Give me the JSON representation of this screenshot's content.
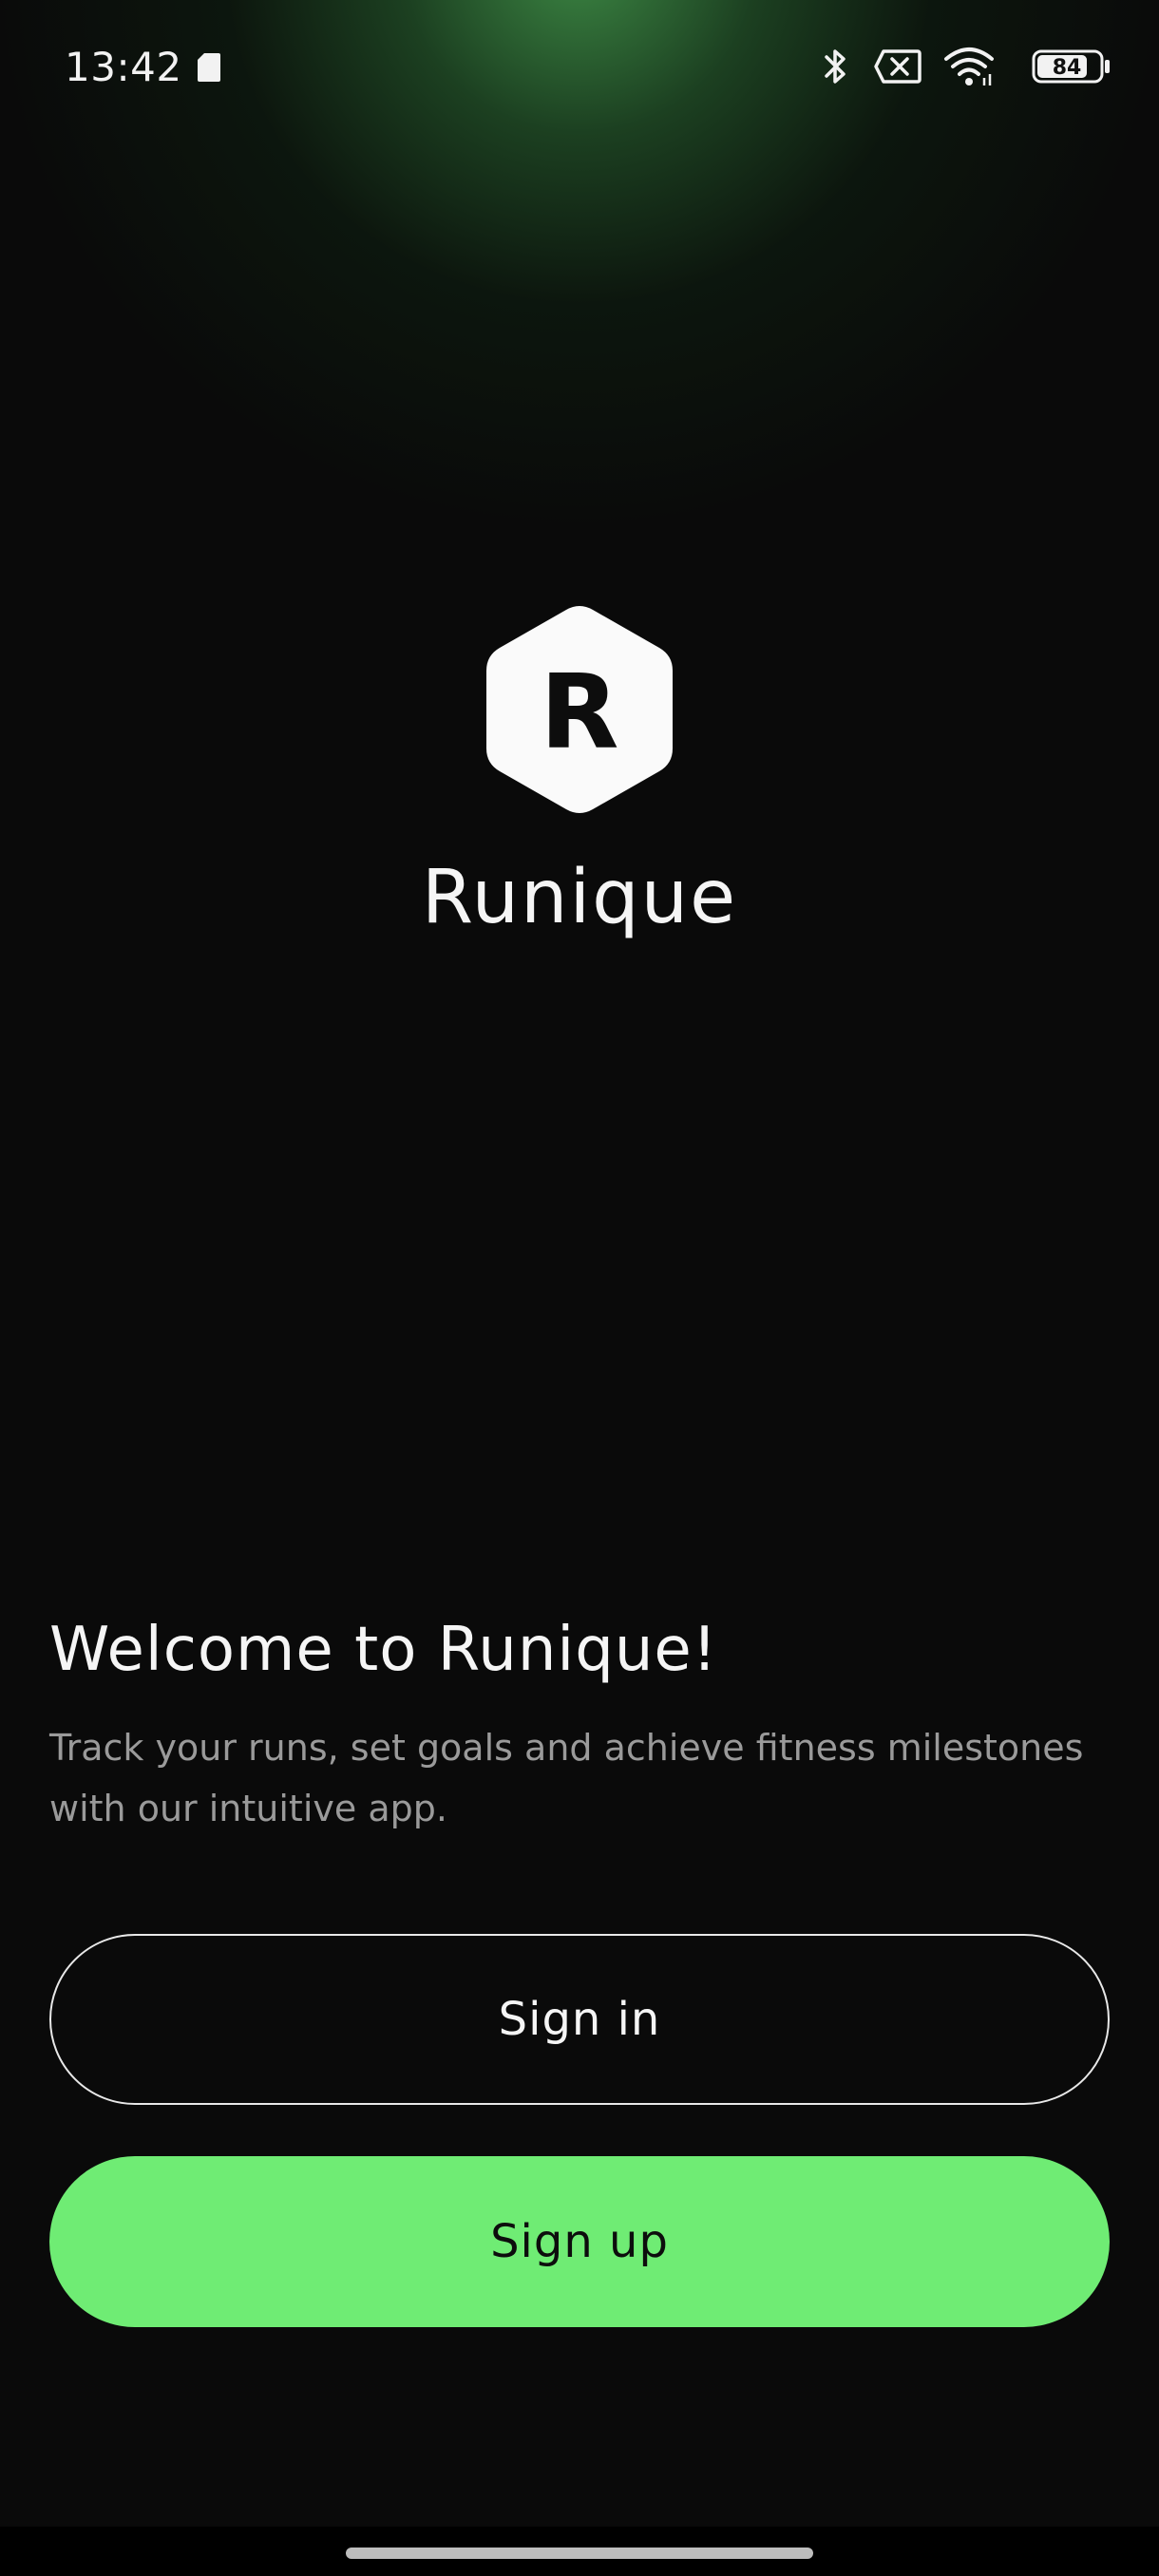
{
  "status_bar": {
    "time": "13:42",
    "battery": "84",
    "icons": [
      "sim-card-icon",
      "bluetooth-icon",
      "no-signal-icon",
      "wifi-icon",
      "battery-icon"
    ]
  },
  "app": {
    "logo_letter": "R",
    "name": "Runique"
  },
  "welcome": {
    "title": "Welcome to Runique!",
    "description": "Track your runs, set goals and achieve fitness milestones with our intuitive app."
  },
  "buttons": {
    "sign_in": "Sign in",
    "sign_up": "Sign up"
  },
  "colors": {
    "background": "#0a0a0a",
    "accent": "#6fec74",
    "glow": "#3e8c46"
  }
}
